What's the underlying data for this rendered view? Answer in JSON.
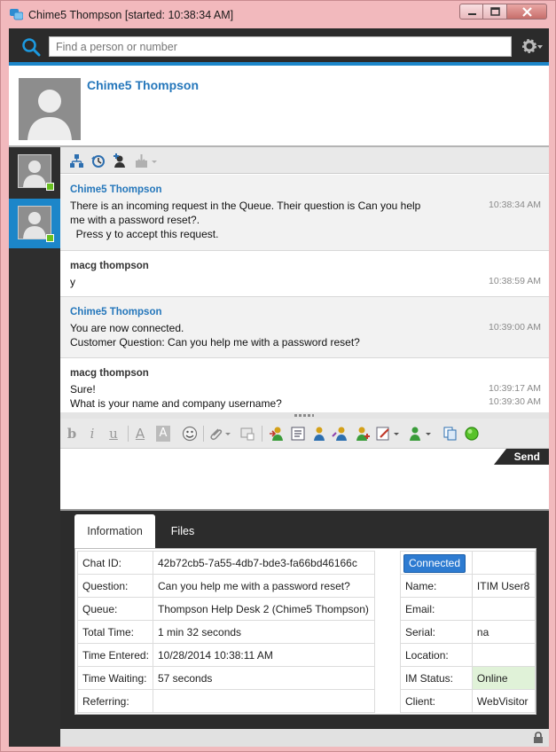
{
  "window": {
    "title": "Chime5 Thompson [started: 10:38:34 AM]"
  },
  "search": {
    "placeholder": "Find a person or number"
  },
  "profile": {
    "name": "Chime5 Thompson"
  },
  "messages": [
    {
      "sender": "Chime5 Thompson",
      "sender_color": "#2577bb",
      "lines": [
        "There is an incoming request in the Queue. Their question is Can you help",
        "me with a password reset?.",
        "  Press y to accept this request."
      ],
      "times": [
        "10:38:34 AM"
      ]
    },
    {
      "sender": "macg thompson",
      "sender_color": "#333333",
      "lines": [
        "y"
      ],
      "times": [
        "10:38:59 AM"
      ]
    },
    {
      "sender": "Chime5 Thompson",
      "sender_color": "#2577bb",
      "lines": [
        "You are now connected.",
        "Customer Question: Can you help me with a password reset?"
      ],
      "times": [
        "10:39:00 AM"
      ]
    },
    {
      "sender": "macg thompson",
      "sender_color": "#333333",
      "lines": [
        "Sure!",
        "What is your name and company username?"
      ],
      "times": [
        "10:39:17 AM",
        "10:39:30 AM"
      ]
    }
  ],
  "format_bar": {
    "bold": "b",
    "italic": "i",
    "underline": "u",
    "font_color": "A",
    "highlight": "A"
  },
  "compose": {
    "send_label": "Send"
  },
  "tabs": [
    {
      "label": "Information",
      "active": true
    },
    {
      "label": "Files",
      "active": false
    }
  ],
  "chat_info": [
    {
      "key": "Chat ID:",
      "value": "42b72cb5-7a55-4db7-bde3-fa66bd46166c"
    },
    {
      "key": "Question:",
      "value": "Can you help me with a password reset?"
    },
    {
      "key": "Queue:",
      "value": "Thompson Help Desk 2 (Chime5 Thompson)"
    },
    {
      "key": "Total Time:",
      "value": "1 min 32 seconds"
    },
    {
      "key": "Time Entered:",
      "value": "10/28/2014 10:38:11 AM"
    },
    {
      "key": "Time Waiting:",
      "value": "57 seconds"
    },
    {
      "key": "Referring:",
      "value": ""
    }
  ],
  "client_info": {
    "connected_label": "Connected",
    "rows": [
      {
        "key": "Name:",
        "value": "ITIM User8"
      },
      {
        "key": "Email:",
        "value": ""
      },
      {
        "key": "Serial:",
        "value": "na"
      },
      {
        "key": "Location:",
        "value": ""
      },
      {
        "key": "IM Status:",
        "value": "Online"
      },
      {
        "key": "Client:",
        "value": "WebVisitor"
      }
    ]
  },
  "colors": {
    "accent": "#1c86c9",
    "name_blue": "#2577bb",
    "online_green": "#69c020",
    "window_frame": "#f2b9bd"
  }
}
